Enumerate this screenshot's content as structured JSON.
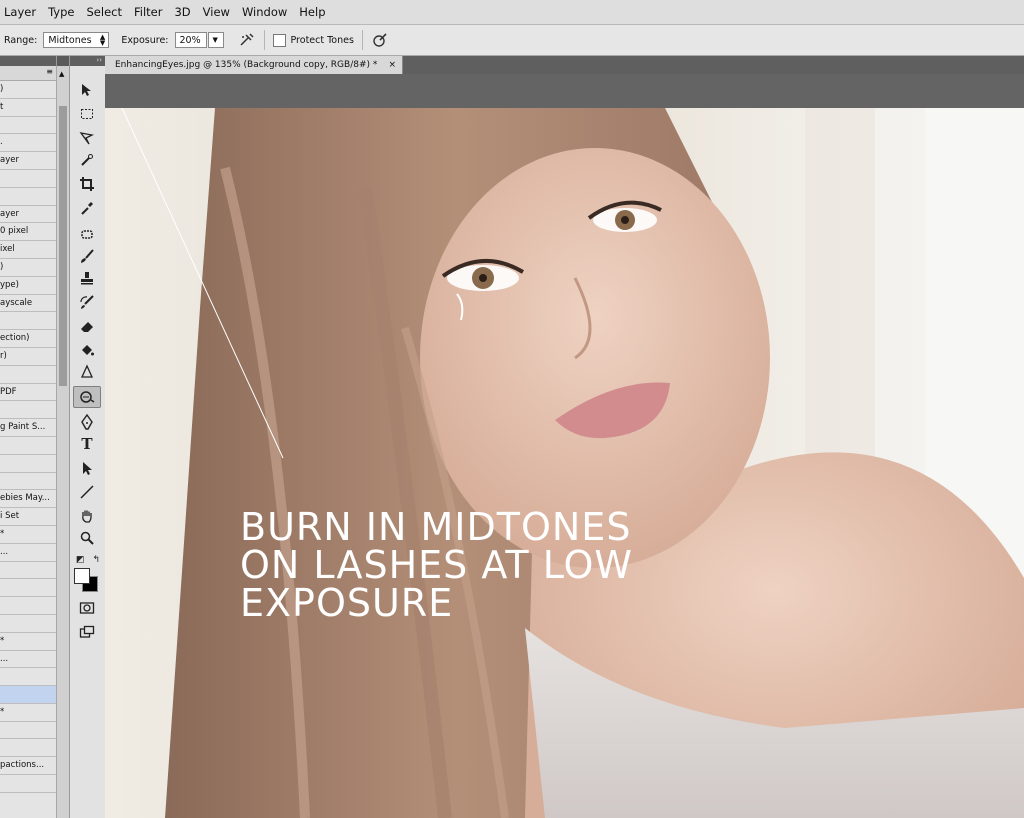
{
  "menu": [
    "Layer",
    "Type",
    "Select",
    "Filter",
    "3D",
    "View",
    "Window",
    "Help"
  ],
  "options": {
    "range_label": "Range:",
    "range_value": "Midtones",
    "exposure_label": "Exposure:",
    "exposure_value": "20%",
    "protect_tones_label": "Protect Tones"
  },
  "document": {
    "tab_title": "EnhancingEyes.jpg @ 135% (Background copy, RGB/8#) *",
    "close_glyph": "×"
  },
  "panel_rows": [
    ")",
    "t",
    "",
    ".",
    "ayer",
    "",
    "",
    "ayer",
    "0 pixel",
    "ixel",
    ")",
    "ype)",
    "ayscale",
    "",
    "ection)",
    "r)",
    "",
    "PDF",
    "",
    "g Paint S...",
    "",
    "",
    "",
    "ebies May...",
    "i Set",
    "*",
    "...",
    "",
    "",
    "",
    "",
    "*",
    "...",
    "",
    "",
    "*",
    "",
    "",
    "pactions...",
    ""
  ],
  "panel_selected_index": 34,
  "caption": "BURN IN MIDTONES\nON LASHES AT LOW\nEXPOSURE",
  "colors": {
    "menubar": "#dedede",
    "panel_selection": "#c2d3ef",
    "workspace": "#646464"
  },
  "icons": {
    "tools": [
      "move-icon",
      "marquee-icon",
      "lasso-icon",
      "quick-select-icon",
      "crop-icon",
      "eyedropper-icon",
      "healing-brush-icon",
      "brush-icon",
      "stamp-icon",
      "history-brush-icon",
      "eraser-icon",
      "paint-bucket-icon",
      "blur-icon",
      "burn-icon",
      "pen-icon",
      "type-icon",
      "path-select-icon",
      "line-icon",
      "hand-icon",
      "zoom-icon"
    ]
  }
}
